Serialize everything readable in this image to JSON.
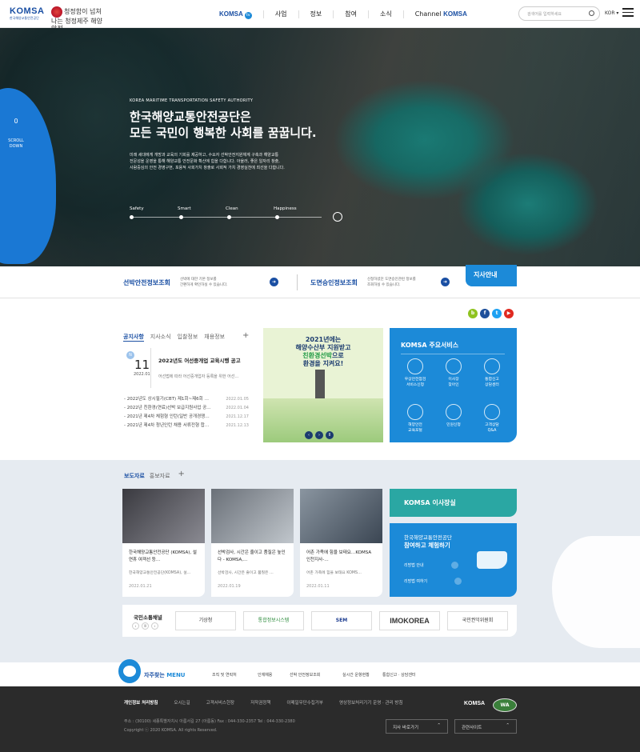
{
  "header": {
    "logo_text": "KOMSA",
    "logo_sub": "한국해양교통안전공단",
    "slogan": "청정함이 넘쳐나는 청정제주 해양안전",
    "nav": [
      "사업",
      "정보",
      "참여",
      "소식"
    ],
    "nav_komsa": "KOMSA",
    "nav_channel": "Channel",
    "nav_channel_brand": "KOMSA",
    "search_placeholder": "검색어를 입력하세요",
    "lang": "KOR ▾"
  },
  "hero": {
    "scroll_num": "0",
    "scroll_label_1": "SCROLL",
    "scroll_label_2": "DOWN",
    "subtitle": "KOREA MARITIME TRANSPORTATION SAFETY AUTHORITY",
    "title_1": "한국해양교통안전공단은",
    "title_2": "모든 국민이 행복한 사회를 꿈꿉니다.",
    "desc_1": "미래 세대에게 개방과 교육의 기회를 제공하고, 수요자 선박안전지원체계 구축과 해양교통",
    "desc_2": "전문성을 운영을 통해 해양교통 안전문화 확산에 힘을 다합니다. 아울러, 좋은 일자리 창출,",
    "desc_3": "사람중심의 안전 경영구현, 포용적 사회가치 창출로 사회적 가치 경영실천에 최선을 다합니다.",
    "steps": [
      "Safety",
      "Smart",
      "Clean",
      "Happiness"
    ]
  },
  "quick": {
    "item1_title": "선박안전정보조회",
    "item1_desc_1": "선박에 대한 기본 정보를",
    "item1_desc_2": "간편하게 확인하실 수 있습니다.",
    "item2_title": "도면승인정보조회",
    "item2_desc_1": "신청하셨던 도면승인관련 정보를",
    "item2_desc_2": "조회하실 수 있습니다.",
    "branch": "지사안내"
  },
  "sns": [
    "b",
    "f",
    "t",
    "▶"
  ],
  "notice": {
    "tabs": [
      "공지사항",
      "지사소식",
      "입찰정보",
      "채용정보"
    ],
    "plus": "+",
    "headline": {
      "badge": "N",
      "day": "11",
      "ym": "2022.01",
      "title": "2022년도 어선중개업 교육시행 공고",
      "text": "어선법에 따라 어선중개업자 등록을 위한 어선…"
    },
    "items": [
      {
        "title": "- 2022년도 상시필기(CBT) 제1회~제6회 …",
        "date": "2022.01.05"
      },
      {
        "title": "- 2022년 친환경(연료)선박 보급지원사업 공…",
        "date": "2022.01.04"
      },
      {
        "title": "- 2021년 제4차 체험형 인턴(일반 공개경쟁…",
        "date": "2021.12.17"
      },
      {
        "title": "- 2021년 제4차 청년인턴 채용 서류전형 합…",
        "date": "2021.12.13"
      }
    ]
  },
  "banner": {
    "line1": "2021년에는",
    "line2": "해양수산부 지원받고",
    "line3a": "친환경선박",
    "line3b": "으로",
    "line4": "환경을 지켜요!",
    "ctrl": [
      "‹",
      "›",
      "II"
    ]
  },
  "services": {
    "title": "KOMSA 주요서비스",
    "items": [
      {
        "l1": "우상안전점검",
        "l2": "서비스신청"
      },
      {
        "l1": "이사장",
        "l2": "찾아인"
      },
      {
        "l1": "통합신고",
        "l2": "상담센터"
      },
      {
        "l1": "해양안전",
        "l2": "교육포털"
      },
      {
        "l1": "민원신청",
        "l2": ""
      },
      {
        "l1": "고객상담",
        "l2": "Q&A"
      }
    ]
  },
  "press": {
    "tab_on": "보도자료",
    "tab_off": "홍보자료",
    "plus": "+",
    "cards": [
      {
        "title": "한국해양교통안전공단 (KOMSA), 설 연휴 여객선 등…",
        "sub": "한국해양교통안전공단(KOMSA), 설…",
        "date": "2022.01.21"
      },
      {
        "title": "선박검사, 시간은 줄이고 품질은 높인다 - KOMSA,…",
        "sub": "선박검사, 시간은 줄이고 품질은 …",
        "date": "2022.01.19"
      },
      {
        "title": "어촌 가족에 힘을 보태요…KOMSA 인천지사-…",
        "sub": "어촌 가족에 힘을 보태요 KOMS…",
        "date": "2022.01.11"
      }
    ]
  },
  "ceo": "KOMSA 이사장실",
  "experience": {
    "line1": "한국해양교통안전공단",
    "line2": "참여하고 체험하기",
    "link1": "리방법 안내",
    "link2": "리방법 여하기"
  },
  "channels": {
    "title": "국민소통채널",
    "ctrl": [
      "‹",
      "II",
      "›"
    ],
    "logos": [
      "기상청",
      "통합정보시스템",
      "SEM",
      "IMOKOREA",
      "국민권익위원회"
    ]
  },
  "freq": {
    "title_a": "자주찾는",
    "title_b": "MENU",
    "links": [
      "조직 및 연락처",
      "인재채용",
      "선박 안전정보조회",
      "실시간 운항현황",
      "통합신고 · 상담센터"
    ]
  },
  "footer": {
    "links": [
      "개인정보 처리방침",
      "오시는길",
      "고객서비스헌장",
      "저작권정책",
      "이메일무단수집거부",
      "영상정보처리기기 운영 · 관리 방침"
    ],
    "address": "주소 : (30100) 세종특별자치시 아름서길 27 (아름동)      Fax : 044-330-2357      Tel : 044-330-2380",
    "copyright": "Copyright ⓒ 2020 KOMSA. All rights Reserved.",
    "select1": "지사 바로가기",
    "select2": "관련사이트",
    "logo": "KOMSA",
    "wa_mark": "WA"
  }
}
